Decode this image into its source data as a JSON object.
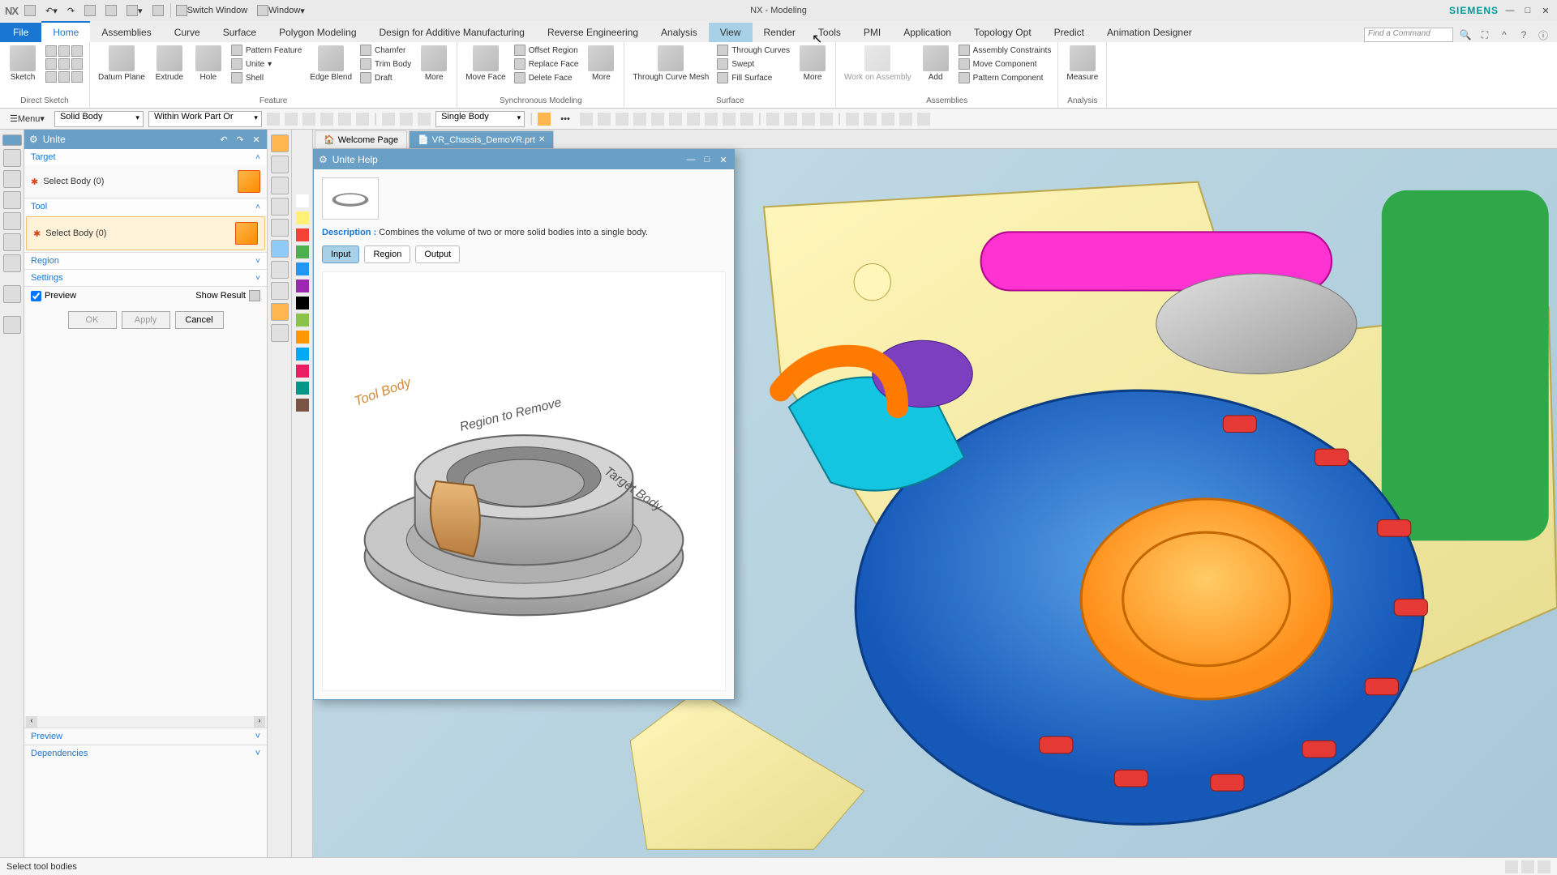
{
  "app": {
    "title": "NX - Modeling",
    "brand": "SIEMENS",
    "logo": "NX"
  },
  "titlebar_items": {
    "switch_window": "Switch Window",
    "window": "Window"
  },
  "ribbon_tabs": {
    "file": "File",
    "items": [
      "Home",
      "Assemblies",
      "Curve",
      "Surface",
      "Polygon Modeling",
      "Design for Additive Manufacturing",
      "Reverse Engineering",
      "Analysis",
      "View",
      "Render",
      "Tools",
      "PMI",
      "Application",
      "Topology Opt",
      "Predict",
      "Animation Designer"
    ],
    "active": "Home",
    "near_cursor": "View",
    "search_placeholder": "Find a Command"
  },
  "ribbon": {
    "groups": [
      {
        "label": "Direct Sketch",
        "big": [
          {
            "label": "Sketch"
          }
        ]
      },
      {
        "label": "Feature",
        "big": [
          {
            "label": "Datum\nPlane"
          },
          {
            "label": "Extrude"
          },
          {
            "label": "Hole"
          }
        ],
        "col1": [
          {
            "label": "Pattern Feature"
          },
          {
            "label": "Unite"
          },
          {
            "label": "Shell"
          }
        ],
        "big2": [
          {
            "label": "Edge\nBlend"
          }
        ],
        "col2": [
          {
            "label": "Chamfer"
          },
          {
            "label": "Trim Body"
          },
          {
            "label": "Draft"
          }
        ],
        "more": "More"
      },
      {
        "label": "Synchronous Modeling",
        "big": [
          {
            "label": "Move\nFace"
          }
        ],
        "col1": [
          {
            "label": "Offset Region"
          },
          {
            "label": "Replace Face"
          },
          {
            "label": "Delete Face"
          }
        ],
        "more": "More"
      },
      {
        "label": "Surface",
        "big": [
          {
            "label": "Through\nCurve Mesh"
          }
        ],
        "col1": [
          {
            "label": "Through Curves"
          },
          {
            "label": "Swept"
          },
          {
            "label": "Fill Surface"
          }
        ],
        "more": "More"
      },
      {
        "label": "Assemblies",
        "big": [
          {
            "label": "Work on\nAssembly",
            "disabled": true
          },
          {
            "label": "Add"
          }
        ],
        "col1": [
          {
            "label": "Assembly Constraints"
          },
          {
            "label": "Move Component"
          },
          {
            "label": "Pattern Component"
          }
        ]
      },
      {
        "label": "Analysis",
        "big": [
          {
            "label": "Measure"
          }
        ]
      }
    ]
  },
  "filterbar": {
    "menu": "Menu",
    "sel1": "Solid Body",
    "sel2": "Within Work Part Or",
    "sel3": "Single Body"
  },
  "panel": {
    "title": "Unite",
    "sections": {
      "target": {
        "title": "Target",
        "row_label": "Select Body (0)"
      },
      "tool": {
        "title": "Tool",
        "row_label": "Select Body (0)"
      },
      "region": "Region",
      "settings": "Settings"
    },
    "preview_chk": "Preview",
    "show_result": "Show Result",
    "btn_ok": "OK",
    "btn_apply": "Apply",
    "btn_cancel": "Cancel",
    "foot_preview": "Preview",
    "foot_dependencies": "Dependencies"
  },
  "doc_tabs": {
    "welcome": "Welcome Page",
    "file": "VR_Chassis_DemoVR.prt"
  },
  "help": {
    "title": "Unite Help",
    "desc_label": "Description :",
    "desc_text": "Combines the volume of two or more solid bodies into a single body.",
    "tabs": [
      "Input",
      "Region",
      "Output"
    ],
    "active": "Input",
    "labels": {
      "tool": "Tool Body",
      "region": "Region to Remove",
      "target": "Target Body"
    }
  },
  "status": {
    "text": "Select tool bodies"
  },
  "swatches": [
    "#ffffff",
    "#fff176",
    "#f44336",
    "#4caf50",
    "#2196f3",
    "#9c27b0",
    "#000000",
    "#8bc34a",
    "#ff9800",
    "#03a9f4",
    "#e91e63",
    "#009688",
    "#795548"
  ]
}
